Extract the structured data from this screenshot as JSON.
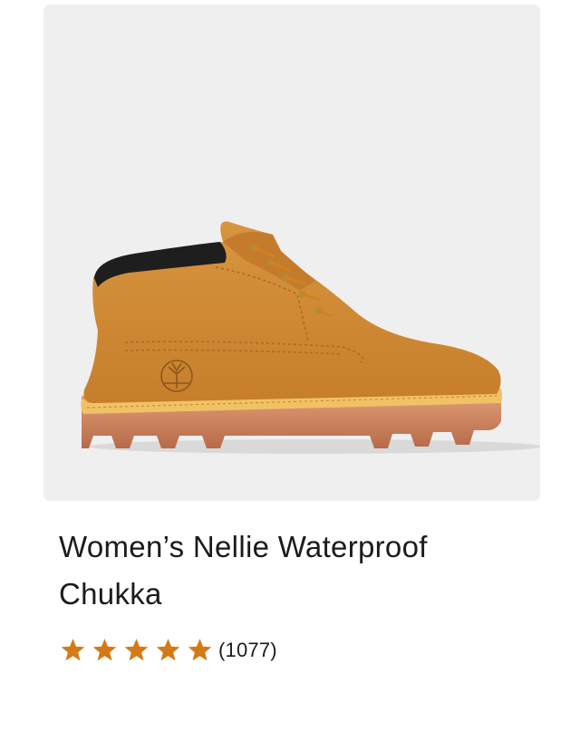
{
  "product": {
    "title": "Women’s Nellie Waterproof Chukka",
    "image": {
      "icon": "chukka-boot-image",
      "background_color": "#efefef",
      "boot_color": "#d18a33"
    },
    "rating": {
      "stars": 5,
      "max_stars": 5,
      "star_color": "#d47a15",
      "review_count": "(1077)"
    }
  }
}
